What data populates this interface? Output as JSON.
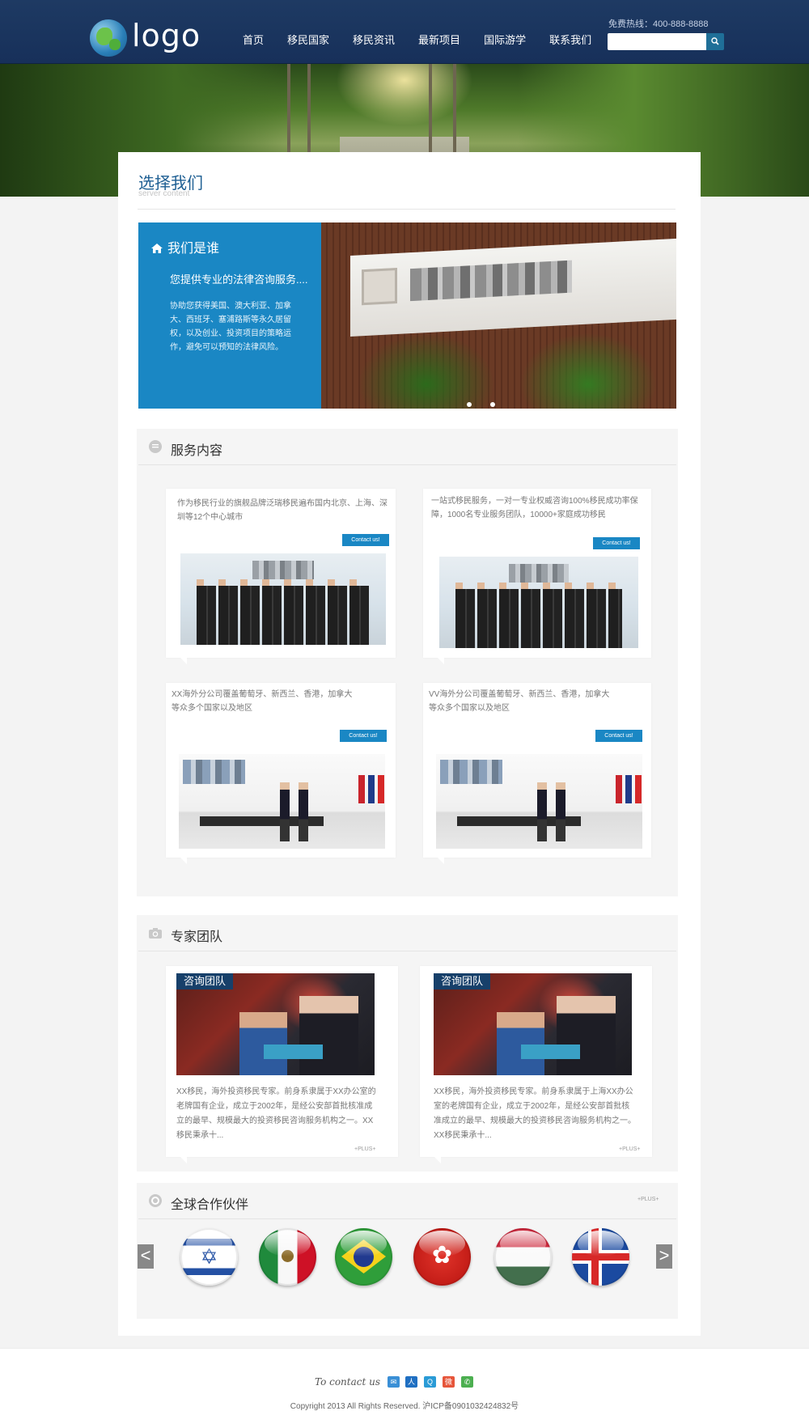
{
  "header": {
    "logo_text": "logo",
    "nav": [
      "首页",
      "移民国家",
      "移民资讯",
      "最新项目",
      "国际游学",
      "联系我们"
    ],
    "hotline": "免费热线：400-888-8888",
    "search_placeholder": "",
    "colors": {
      "bar": "#1e3a63",
      "accent": "#1a87c4"
    }
  },
  "about": {
    "title": "选择我们",
    "subtitle": "server content",
    "slide": {
      "heading": "我们是谁",
      "tagline": "您提供专业的法律咨询服务....",
      "description": "协助您获得美国、澳大利亚、加拿大、西班牙、塞浦路斯等永久居留权，以及创业、投资项目的策略运作，避免可以预知的法律风险。",
      "dot_count": 2
    }
  },
  "services": {
    "title": "服务内容",
    "cards": [
      {
        "text": "作为移民行业的旗舰品牌泛瑞移民遍布国内北京、上海、深圳等12个中心城市",
        "button": "Contact us!",
        "photo": "group"
      },
      {
        "text": "一站式移民服务，一对一专业权威咨询100%移民成功率保障，1000名专业服务团队，10000+家庭成功移民",
        "button": "Contact us!",
        "photo": "group"
      },
      {
        "text": "XX海外分公司覆盖葡萄牙、新西兰、香港，加拿大等众多个国家以及地区",
        "button": "Contact us!",
        "photo": "lobby"
      },
      {
        "text": "VV海外分公司覆盖葡萄牙、新西兰、香港，加拿大等众多个国家以及地区",
        "button": "Contact us!",
        "photo": "lobby"
      }
    ]
  },
  "experts": {
    "title": "专家团队",
    "cards": [
      {
        "label": "咨询团队",
        "text": "XX移民，海外投资移民专家。前身系隶属于XX办公室的老牌国有企业，成立于2002年，是经公安部首批核准成立的最早、规模最大的投资移民咨询服务机构之一。XX移民秉承十...",
        "more": "+PLUS+"
      },
      {
        "label": "咨询团队",
        "text": "XX移民，海外投资移民专家。前身系隶属于上海XX办公室的老牌国有企业，成立于2002年，是经公安部首批核准成立的最早、规模最大的投资移民咨询服务机构之一。XX移民秉承十...",
        "more": "+PLUS+"
      }
    ]
  },
  "partners": {
    "title": "全球合作伙伴",
    "more": "+PLUS+",
    "prev": "<",
    "next": ">",
    "flags": [
      "israel-flag-icon",
      "mexico-flag-icon",
      "brazil-flag-icon",
      "hong-kong-flag-icon",
      "hungary-flag-icon",
      "iceland-flag-icon"
    ]
  },
  "footer": {
    "contact_label": "To contact us",
    "social_icons": [
      "mail-icon",
      "renren-icon",
      "qq-icon",
      "weibo-icon",
      "wechat-icon"
    ],
    "copyright": "Copyright 2013 All Rights Reserved. 沪ICP备0901032424832号"
  }
}
